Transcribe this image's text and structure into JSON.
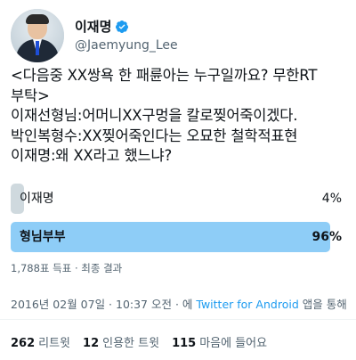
{
  "author": {
    "display_name": "이재명",
    "handle": "@Jaemyung_Lee",
    "verified_icon": "verified-badge-icon",
    "verified_color": "#1d9bf0"
  },
  "tweet": {
    "lines": [
      "<다음중 XX쌍욕 한 패륜아는 누구일까요?  무한RT",
      "부탁>",
      "이재선형님:어머니XX구멍을 칼로찢어죽이겠다.",
      "박인복형수:XX찢어죽인다는 오묘한 철학적표현",
      "이재명:왜 XX라고 했느냐?"
    ]
  },
  "poll": {
    "options": [
      {
        "label": "이재명",
        "percent_text": "4%",
        "percent": 4,
        "color": "#cfd9de",
        "leading": false
      },
      {
        "label": "형님부부",
        "percent_text": "96%",
        "percent": 96,
        "color": "#8ecdf7",
        "leading": true
      }
    ],
    "meta": "1,788표 득표 · 최종 결과"
  },
  "timestamp": {
    "datetime": "2016년 02월 07일 · 10:37 오전 · 에 ",
    "source": "Twitter for Android",
    "suffix": " 앱을 통해"
  },
  "stats": {
    "retweets_count": "262",
    "retweets_label": "리트윗",
    "quotes_count": "12",
    "quotes_label": "인용한 트윗",
    "likes_count": "115",
    "likes_label": "마음에 들어요"
  }
}
